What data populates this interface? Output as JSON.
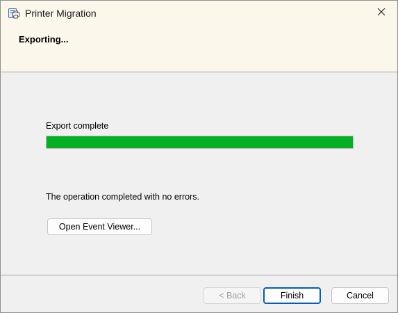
{
  "window": {
    "title": "Printer Migration",
    "close_icon": "close-icon",
    "app_icon": "printer-migration-icon"
  },
  "header": {
    "title": "Exporting..."
  },
  "progress": {
    "label": "Export complete",
    "percent": 100,
    "color": "#06b025"
  },
  "result": {
    "message": "The operation completed with no errors."
  },
  "buttons": {
    "event_viewer": "Open Event Viewer...",
    "back": "< Back",
    "back_enabled": false,
    "finish": "Finish",
    "cancel": "Cancel"
  },
  "colors": {
    "header_background": "#fbf7ea",
    "dialog_background": "#f0f0f0",
    "default_button_border": "#005fb8"
  }
}
